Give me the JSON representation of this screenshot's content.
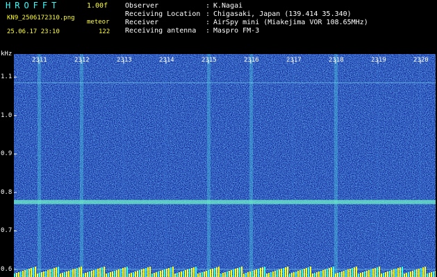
{
  "header": {
    "logo": "HROFFT",
    "version": "1.00f",
    "filename": "KN9_2506172310.png",
    "mode": "meteor",
    "timestamp": "25.06.17 23:10",
    "count": "122",
    "info": [
      {
        "label": "Observer",
        "value": "K.Nagai"
      },
      {
        "label": "Receiving Location",
        "value": "Chigasaki, Japan (139.414 35.340)"
      },
      {
        "label": "Receiver",
        "value": "AirSpy mini (Miakejima VOR 108.65MHz)"
      },
      {
        "label": "Receiving antenna",
        "value": "Maspro FM-3"
      }
    ]
  },
  "colors": {
    "background": "#1a3ccc",
    "label_text": "#ffffff",
    "logo": "#33ffff",
    "header_values": "#ffff33"
  },
  "chart_data": {
    "type": "heatmap",
    "title": "",
    "y_unit": "kHz",
    "x_ticks": [
      "2311",
      "2312",
      "2313",
      "2314",
      "2315",
      "2316",
      "2317",
      "2318",
      "2319",
      "2320"
    ],
    "y_ticks": [
      "1.1",
      "1.0",
      "0.9",
      "0.8",
      "0.7",
      "0.6"
    ],
    "ylim": [
      0.58,
      1.16
    ],
    "signal_lines_khz": [
      0.775,
      0.6,
      1.085
    ],
    "meteor_columns": [
      "2311",
      "2312",
      "2315",
      "2316",
      "2318"
    ]
  }
}
